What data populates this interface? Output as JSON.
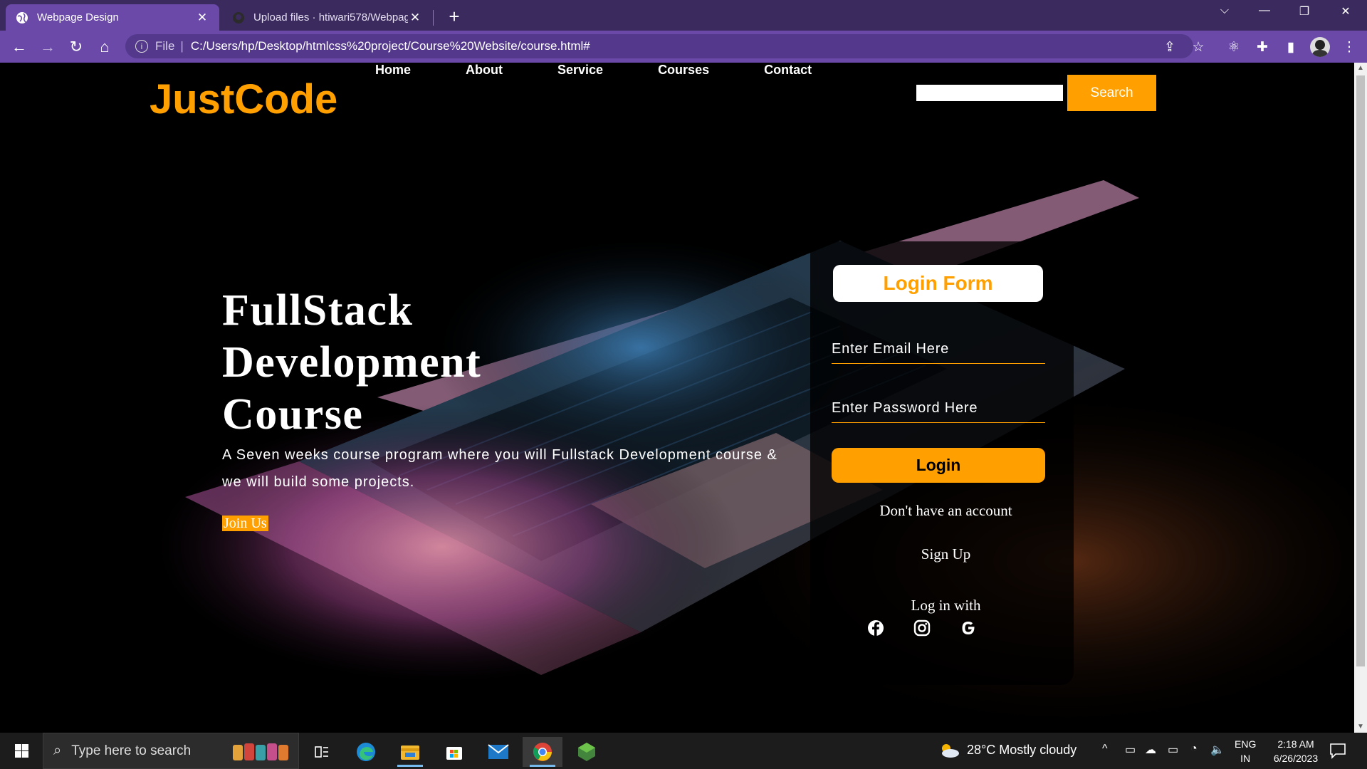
{
  "browser": {
    "tabs": [
      {
        "title": "Webpage Design",
        "close": "✕",
        "icon": "globe-icon"
      },
      {
        "title": "Upload files · htiwari578/Webpag",
        "close": "✕",
        "icon": "github-icon"
      }
    ],
    "new_tab": "+",
    "address": {
      "scheme": "File",
      "separator": "|",
      "url": "C:/Users/hp/Desktop/htmlcss%20project/Course%20Website/course.html#"
    }
  },
  "site": {
    "logo": "JustCode",
    "nav": [
      "Home",
      "About",
      "Service",
      "Courses",
      "Contact"
    ],
    "search": {
      "placeholder": "",
      "button": "Search"
    },
    "hero": {
      "title": "FullStack Development Course",
      "description": "A Seven weeks course program where you will Fullstack Development course & we will build some projects.",
      "cta": "Join Us"
    },
    "login": {
      "heading": "Login Form",
      "email_placeholder": "Enter Email Here",
      "password_placeholder": "Enter Password Here",
      "button": "Login",
      "no_account": "Don't have an account",
      "signup": "Sign Up",
      "login_with": "Log in with",
      "social": [
        "facebook-icon",
        "instagram-icon",
        "google-icon"
      ]
    },
    "colors": {
      "accent": "#ffa000",
      "browser": "#6a49a8"
    }
  },
  "taskbar": {
    "search_placeholder": "Type here to search",
    "weather": "28°C  Mostly cloudy",
    "lang": [
      "ENG",
      "IN"
    ],
    "time": "2:18 AM",
    "date": "6/26/2023"
  }
}
